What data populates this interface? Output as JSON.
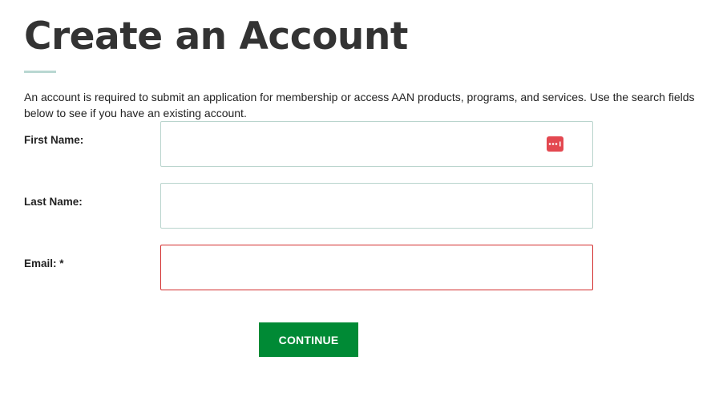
{
  "page": {
    "title": "Create an Account",
    "intro": "An account is required to submit an application for membership or access AAN products, programs, and services. Use the search fields below to see if you have an existing account."
  },
  "form": {
    "first_name": {
      "label": "First Name:",
      "value": "",
      "placeholder": ""
    },
    "last_name": {
      "label": "Last Name:",
      "value": "",
      "placeholder": ""
    },
    "email": {
      "label": "Email: *",
      "value": "",
      "placeholder": "",
      "state": "invalid"
    },
    "password_manager_icon": "password-manager-icon",
    "continue_label": "CONTINUE"
  },
  "colors": {
    "primary_button": "#008a35",
    "title_rule": "#b9d8d2",
    "input_border": "#b9d4cd",
    "error_border": "#d32f2f",
    "password_manager_icon": "#e34850"
  }
}
